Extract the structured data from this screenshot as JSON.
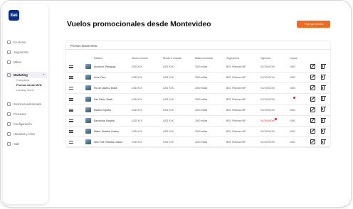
{
  "sidebar": {
    "logo": "itaú",
    "items": [
      {
        "label": "Ex-Home"
      },
      {
        "label": "Segmentos"
      },
      {
        "label": "Millas"
      },
      {
        "label": "Marketing"
      },
      {
        "label": "Servicios adicionales"
      },
      {
        "label": "Procesos"
      },
      {
        "label": "Configuración"
      },
      {
        "label": "Usuarios y roles"
      },
      {
        "label": "Salir"
      }
    ],
    "sub_items": [
      {
        "label": "Campañas"
      },
      {
        "label": "Promos desde MVD"
      },
      {
        "label": "Landing Home"
      }
    ]
  },
  "header": {
    "title": "Vuelos promocionales desde Montevideo",
    "add_button": "+  Agregar destino"
  },
  "table": {
    "title": "Promos desde MVD",
    "columns": [
      "Destino",
      "Monto mínimo",
      "Monto a mostrar",
      "Millas a mostrar",
      "Segmentos",
      "Vigencia",
      "Cupos"
    ],
    "rows": [
      {
        "destino": "Asunción, Paraguay",
        "monto_min": "USD XXX",
        "monto_mostrar": "USD XXX",
        "millas": "2000 millas",
        "segmentos": "B2S, Platinum MP",
        "vigencia": "XX/XX/XXXX",
        "cupos": "1000"
      },
      {
        "destino": "Lima, Perú",
        "monto_min": "USD XXX",
        "monto_mostrar": "USD XXX",
        "millas": "2000 millas",
        "segmentos": "B2S, Platinum MP",
        "vigencia": "XX/XX/XXXX",
        "cupos": "1000"
      },
      {
        "destino": "Río de Janeiro, Brasil",
        "monto_min": "USD XXX",
        "monto_mostrar": "USD XXX",
        "millas": "2000 millas",
        "segmentos": "B2S, Platinum MP",
        "vigencia": "XX/XX/XXXX",
        "cupos": "1000"
      },
      {
        "destino": "Sao Pablo, Brasil",
        "monto_min": "USD XXX",
        "monto_mostrar": "USD XXX",
        "millas": "2000 millas",
        "segmentos": "B2S, Platinum MP",
        "vigencia": "XX/XX/XXXX",
        "cupos": ""
      },
      {
        "destino": "Madrid, España",
        "monto_min": "USD XXX",
        "monto_mostrar": "USD XXX",
        "millas": "2000 millas",
        "segmentos": "B2S, Platinum MP",
        "vigencia": "XX/XX/XXXX",
        "cupos": "1000"
      },
      {
        "destino": "Barcelona, España",
        "monto_min": "USD XXX",
        "monto_mostrar": "USD XXX",
        "millas": "2000 millas",
        "segmentos": "B2S, Platinum MP",
        "vigencia": "XX/XX/XXXX",
        "cupos": "1000"
      },
      {
        "destino": "Miami, Estados Unidos",
        "monto_min": "USD XXX",
        "monto_mostrar": "USD XXX",
        "millas": "2000 millas",
        "segmentos": "B2S, Platinum MP",
        "vigencia": "XX/XX/XXXX",
        "cupos": "1000"
      },
      {
        "destino": "New York, Estados Unidos",
        "monto_min": "USD XXX",
        "monto_mostrar": "USD XXX",
        "millas": "2000 millas",
        "segmentos": "B2S, Platinum MP",
        "vigencia": "XX/XX/XXXX",
        "cupos": "1000"
      }
    ]
  },
  "colors": {
    "brand": "#0b2e8a",
    "accent": "#f26a1b",
    "alert": "#e02020"
  }
}
